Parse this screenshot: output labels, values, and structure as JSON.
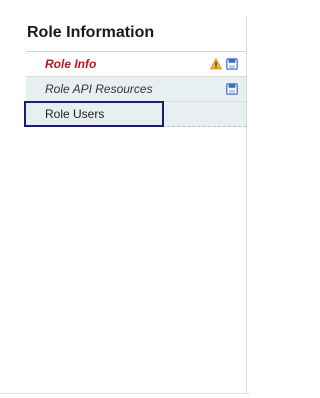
{
  "panel": {
    "title": "Role Information",
    "items": [
      {
        "label": "Role Info",
        "state": "active",
        "icons": [
          "warning-icon",
          "save-icon"
        ]
      },
      {
        "label": "Role API Resources",
        "state": "shaded",
        "icons": [
          "save-icon"
        ]
      },
      {
        "label": "Role Users",
        "state": "selected",
        "icons": []
      }
    ]
  },
  "colors": {
    "active_text": "#b01c1c",
    "row_shade": "#e8eff1",
    "focus_border": "#1a1d6e",
    "warning_fill": "#f2b632",
    "save_icon": "#3a6fc4"
  }
}
